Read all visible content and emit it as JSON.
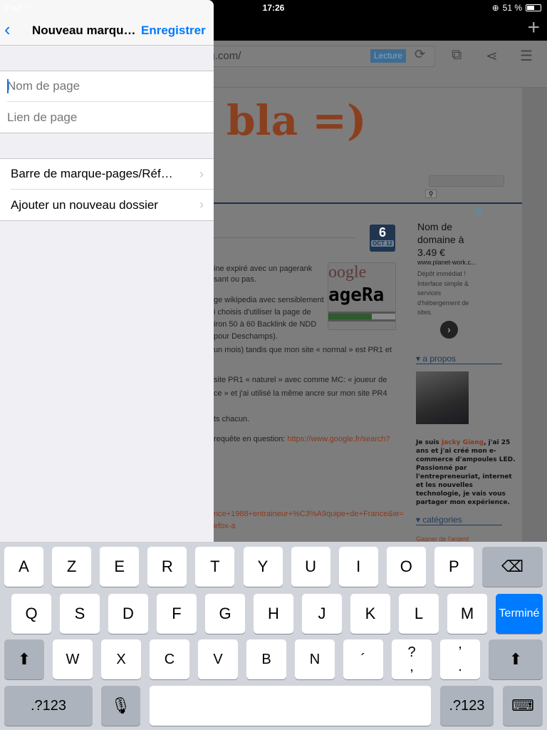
{
  "status_bar": {
    "carrier": "iPad",
    "time": "17:26",
    "battery": "51 %",
    "battery_level": 0.51
  },
  "browser": {
    "url": "ng.com/",
    "reader_label": "Lecture",
    "icons": [
      "plus-icon",
      "reload-icon",
      "puzzle-icon",
      "share-icon",
      "list-icon"
    ]
  },
  "webpage": {
    "logo": "bla =)",
    "date_day": "6",
    "date_month": "OCT 12",
    "pr_image": {
      "top": "oogle",
      "bottom": "ageRa",
      "bar_fill": 0.64
    },
    "article_lines": [
      "ine expiré avec un pagerank",
      "sant ou pas.",
      "ge wikipedia avec sensiblement",
      "i choisis d'utiliser la page de",
      "iron 50 à 60 Backlink de NDD",
      "pour Deschamps).",
      "un mois) tandis que mon site « normal » est PR1 et",
      "site PR1 « naturel » avec comme MC: « joueur de",
      "ce » et j'ai utilisé la même ancre sur mon site PR4",
      "ts chacun."
    ],
    "query_prefix": "requête en question: ",
    "query_link": "https://www.google.fr/search?",
    "link_line1": "nce+1988+entraineur+%C3%A9quipe+de+France&ie=",
    "link_line2": "efox-a",
    "ad": {
      "title": "Nom de domaine à 3.49 €",
      "domain": "www.planet-work.c...",
      "desc": "Dépôt immédiat ! Interface simple & services d'hébergement de sites."
    },
    "about_heading": "a propos",
    "bio_prefix": "Je suis ",
    "bio_name": "Jacky Giang",
    "bio_rest": ", j'ai 25 ans et j'ai créé mon e-commerce d'ampoules LED. Passionné par l'entrepreneuriat, internet et les nouvelles technologie, je vais vous partager mon expérience.",
    "categories_heading": "catégories",
    "category_first": "Gagner de l'argent"
  },
  "panel": {
    "title": "Nouveau marqu…",
    "save_label": "Enregistrer",
    "name_placeholder": "Nom de page",
    "link_placeholder": "Lien de page",
    "location": "Barre de marque-pages/Réf…",
    "new_folder": "Ajouter un nouveau dossier"
  },
  "keyboard": {
    "row1": [
      "A",
      "Z",
      "E",
      "R",
      "T",
      "Y",
      "U",
      "I",
      "O",
      "P"
    ],
    "row2": [
      "Q",
      "S",
      "D",
      "F",
      "G",
      "H",
      "J",
      "K",
      "L",
      "M"
    ],
    "row3": [
      "W",
      "X",
      "C",
      "V",
      "B",
      "N",
      "´",
      "?\n,",
      "’\n."
    ],
    "done_label": "Terminé",
    "numbers_label": ".?123",
    "accent_color": "#007aff"
  }
}
